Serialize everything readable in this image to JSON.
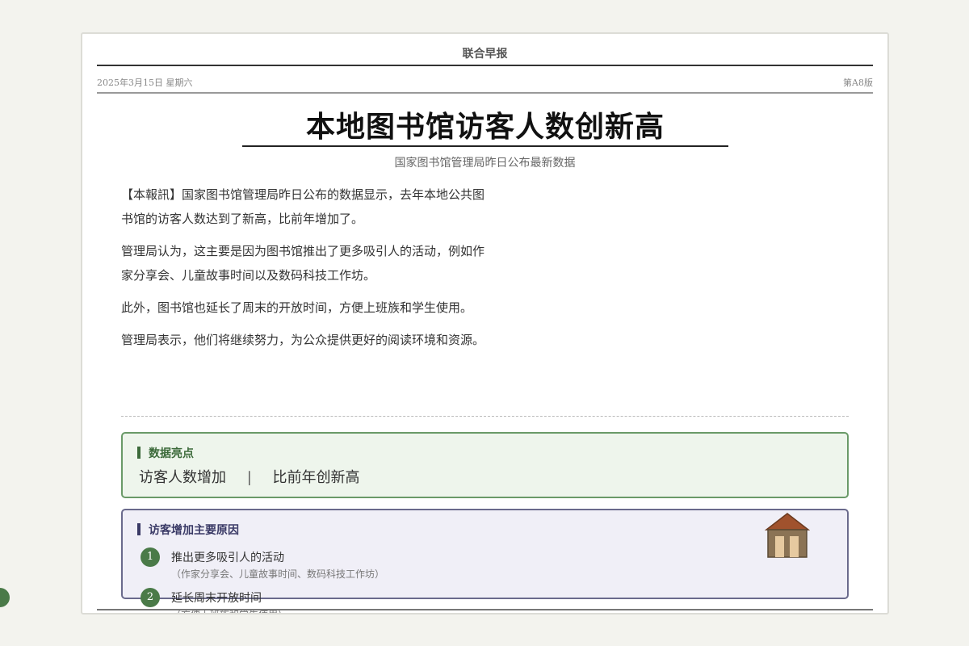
{
  "masthead": {
    "name": "联合早报"
  },
  "dateline": {
    "date": "2025年3月15日 星期六",
    "page": "第A8版"
  },
  "article": {
    "headline": "本地图书馆访客人数创新高",
    "subheadline": "国家图书馆管理局昨日公布最新数据",
    "paragraphs": [
      "【本報訊】国家图书馆管理局昨日公布的数据显示，去年本地公共图书馆的访客人数达到了新高，比前年增加了。",
      "管理局认为，这主要是因为图书馆推出了更多吸引人的活动，例如作家分享会、儿童故事时间以及数码科技工作坊。",
      "此外，图书馆也延长了周末的开放时间，方便上班族和学生使用。",
      "管理局表示，他们将继续努力，为公众提供更好的阅读环境和资源。"
    ]
  },
  "highlights": {
    "title": "数据亮点",
    "items": [
      "访客人数增加",
      "比前年创新高"
    ]
  },
  "reasons": {
    "title": "访客增加主要原因",
    "icon": "library-building-icon",
    "items": [
      {
        "number": "1",
        "title": "推出更多吸引人的活动",
        "note": "（作家分享会、儿童故事时间、数码科技工作坊）"
      },
      {
        "number": "2",
        "title": "延长周末开放时间",
        "note": "（方便上班族和学生使用）"
      }
    ]
  },
  "colors": {
    "accent_green": "#4a7a48",
    "highlight_bg": "#eef5ec",
    "reasons_bg": "#f0eff7",
    "reasons_border": "#6a6a8c"
  }
}
